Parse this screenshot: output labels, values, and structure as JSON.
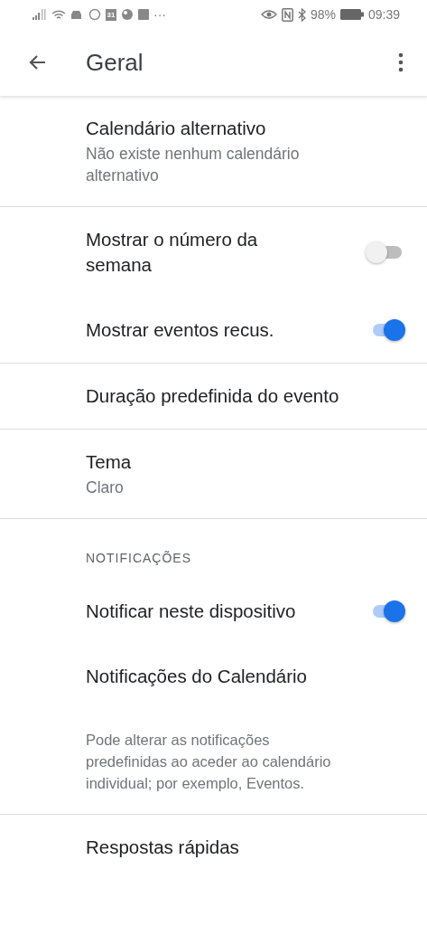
{
  "status_bar": {
    "calendar_day": "31",
    "more": "···",
    "battery": "98%",
    "time": "09:39"
  },
  "app_bar": {
    "title": "Geral"
  },
  "items": [
    {
      "kind": "item",
      "title": "Calendário alternativo",
      "subtitle": "Não existe nenhum calendário alternativo"
    },
    {
      "kind": "divider"
    },
    {
      "kind": "toggle",
      "title": "Mostrar o número da semana",
      "on": false
    },
    {
      "kind": "toggle",
      "title": "Mostrar eventos recus.",
      "on": true
    },
    {
      "kind": "divider"
    },
    {
      "kind": "item",
      "title": "Duração predefinida do evento"
    },
    {
      "kind": "divider"
    },
    {
      "kind": "item",
      "title": "Tema",
      "subtitle": "Claro"
    },
    {
      "kind": "divider"
    },
    {
      "kind": "header",
      "title": "NOTIFICAÇÕES"
    },
    {
      "kind": "toggle",
      "title": "Notificar neste dispositivo",
      "on": true
    },
    {
      "kind": "item",
      "title": "Notificações do Calendário"
    },
    {
      "kind": "note",
      "title": "Pode alterar as notificações predefinidas ao aceder ao calendário individual; por exemplo, Eventos."
    },
    {
      "kind": "divider"
    },
    {
      "kind": "item",
      "title": "Respostas rápidas"
    }
  ]
}
